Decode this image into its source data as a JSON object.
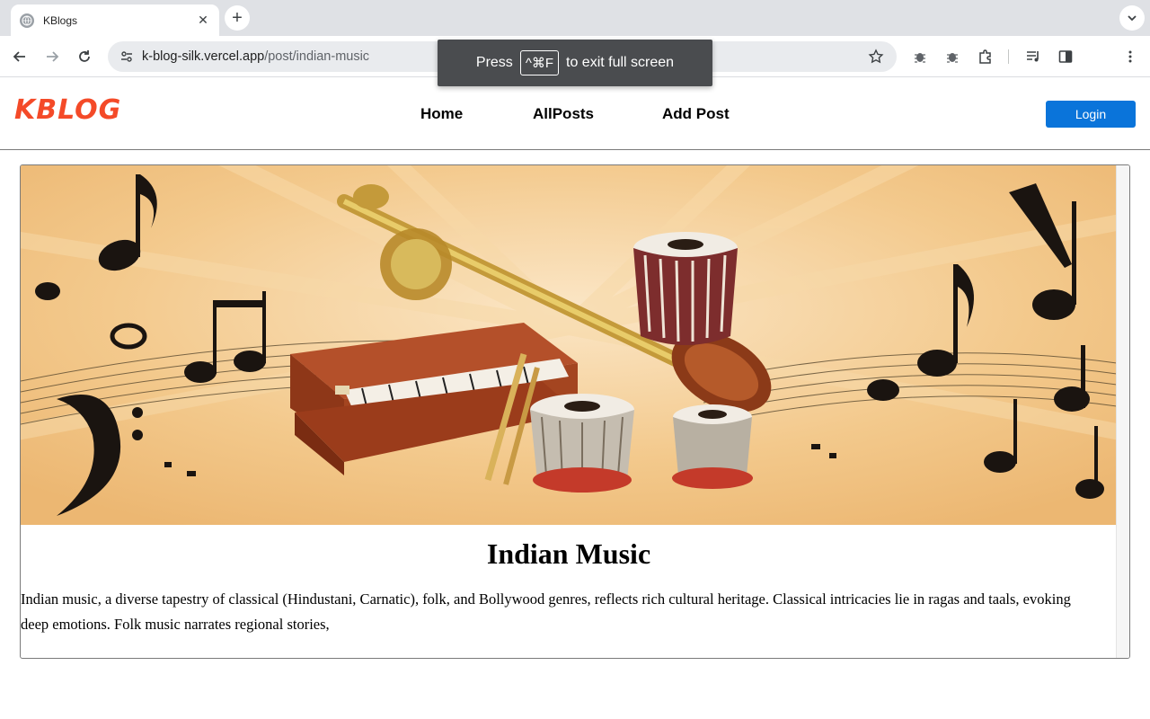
{
  "browser": {
    "tab_title": "KBlogs",
    "url_host": "k-blog-silk.vercel.app",
    "url_path": "/post/indian-music",
    "fullscreen_press": "Press",
    "fullscreen_key": "^⌘F",
    "fullscreen_suffix": "to exit full screen"
  },
  "header": {
    "logo": "KBLOG",
    "nav": [
      "Home",
      "AllPosts",
      "Add Post"
    ],
    "login_label": "Login"
  },
  "post": {
    "title": "Indian Music",
    "body": "Indian music, a diverse tapestry of classical (Hindustani, Carnatic), folk, and Bollywood genres, reflects rich cultural heritage. Classical intricacies lie in ragas and taals, evoking deep emotions. Folk music narrates regional stories,"
  },
  "colors": {
    "logo": "#f44a28",
    "login_button": "#0a74da",
    "image_background": "#f2c88a"
  },
  "icons": [
    "globe-icon",
    "close-icon",
    "plus-icon",
    "chevron-down-icon",
    "back-arrow-icon",
    "forward-arrow-icon",
    "reload-icon",
    "site-settings-icon",
    "star-icon",
    "bug-icon",
    "puzzle-icon",
    "media-icon",
    "sidepanel-icon",
    "more-icon"
  ]
}
